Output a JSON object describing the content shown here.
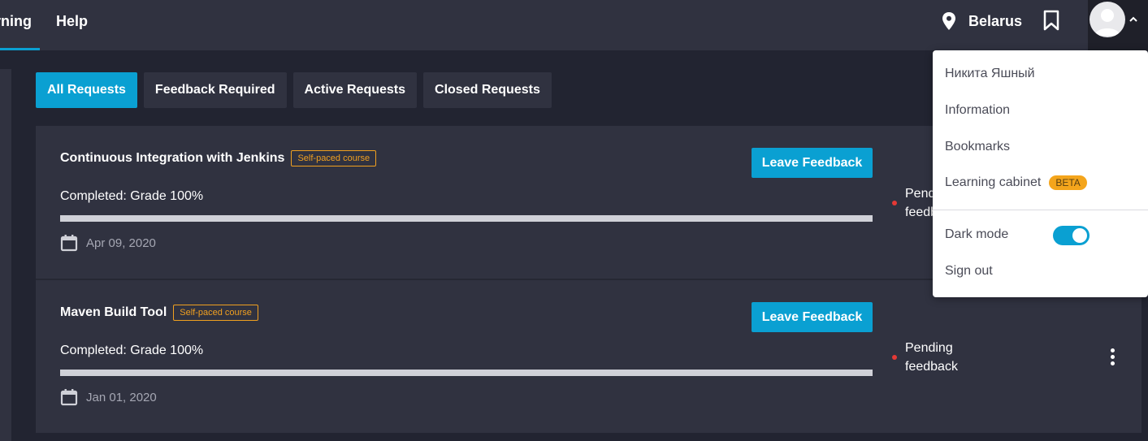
{
  "nav": {
    "learning_label": "rning",
    "help_label": "Help",
    "location": "Belarus"
  },
  "tabs": [
    {
      "label": "All Requests",
      "active": true
    },
    {
      "label": "Feedback Required",
      "active": false
    },
    {
      "label": "Active Requests",
      "active": false
    },
    {
      "label": "Closed Requests",
      "active": false
    }
  ],
  "requests": [
    {
      "title": "Continuous Integration with Jenkins",
      "badge": "Self-paced course",
      "button": "Leave Feedback",
      "completed": "Completed: Grade 100%",
      "progress": 1.0,
      "date": "Apr 09, 2020",
      "status": "Pending feedback"
    },
    {
      "title": "Maven Build Tool",
      "badge": "Self-paced course",
      "button": "Leave Feedback",
      "completed": "Completed: Grade 100%",
      "progress": 1.0,
      "date": "Jan 01, 2020",
      "status": "Pending feedback"
    }
  ],
  "user_menu": {
    "user_name": "Никита Яшный",
    "information": "Information",
    "bookmarks": "Bookmarks",
    "learning_cabinet": "Learning cabinet",
    "beta_badge": "BETA",
    "dark_mode": "Dark mode",
    "dark_mode_on": true,
    "sign_out": "Sign out"
  },
  "colors": {
    "accent": "#0aa0d2",
    "badge_orange": "#f0a020",
    "status_dot": "#e53935",
    "background": "#222431",
    "card": "#303240"
  },
  "icons": {
    "location": "map-pin-icon",
    "bookmark": "bookmark-icon",
    "calendar": "calendar-icon",
    "more": "kebab-menu-icon",
    "chevron": "chevron-up-icon"
  }
}
